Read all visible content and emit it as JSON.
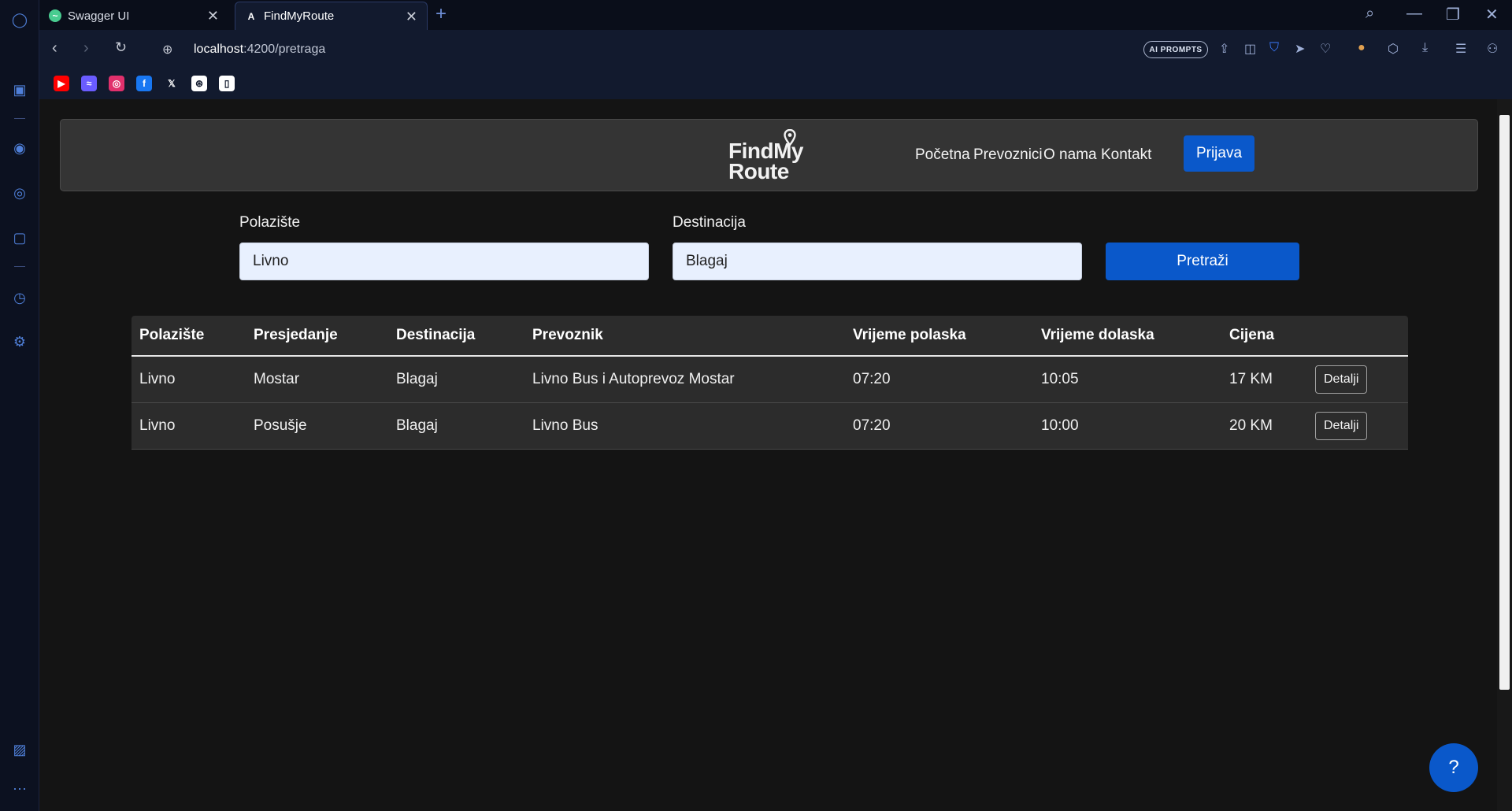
{
  "browser": {
    "tabs": [
      {
        "label": "Swagger UI",
        "favicon": "swagger-icon"
      },
      {
        "label": "FindMyRoute",
        "favicon": "angular-icon"
      }
    ],
    "url_host": "localhost",
    "url_path": ":4200/pretraga",
    "ai_prompts_label": "AI PROMPTS",
    "bookmarks": [
      {
        "name": "youtube-icon",
        "color": "#ff0000",
        "glyph": "▶"
      },
      {
        "name": "messenger-icon",
        "color": "#6a5cff",
        "glyph": "≈"
      },
      {
        "name": "instagram-icon",
        "color": "#e1306c",
        "glyph": "◎"
      },
      {
        "name": "facebook-icon",
        "color": "#1877f2",
        "glyph": "f"
      },
      {
        "name": "x-icon",
        "color": "#121a2e",
        "glyph": "𝕏"
      },
      {
        "name": "chatgpt-icon",
        "color": "#ffffff",
        "glyph": "⊛"
      },
      {
        "name": "document-icon",
        "color": "#ffffff",
        "glyph": "▯"
      }
    ]
  },
  "site": {
    "logo_line1": "FindMy",
    "logo_line2": "Route",
    "nav": [
      "Početna",
      "Prevoznici",
      "O nama",
      "Kontakt"
    ],
    "login_label": "Prijava",
    "accent": "#0a58ca"
  },
  "search": {
    "from_label": "Polazište",
    "from_value": "Livno",
    "to_label": "Destinacija",
    "to_value": "Blagaj",
    "button_label": "Pretraži"
  },
  "results": {
    "headers": [
      "Polazište",
      "Presjedanje",
      "Destinacija",
      "Prevoznik",
      "Vrijeme polaska",
      "Vrijeme dolaska",
      "Cijena",
      ""
    ],
    "rows": [
      [
        "Livno",
        "Mostar",
        "Blagaj",
        "Livno Bus i Autoprevoz Mostar",
        "07:20",
        "10:05",
        "17 KM",
        "Detalji"
      ],
      [
        "Livno",
        "Posušje",
        "Blagaj",
        "Livno Bus",
        "07:20",
        "10:00",
        "20 KM",
        "Detalji"
      ]
    ]
  },
  "help_label": "?"
}
